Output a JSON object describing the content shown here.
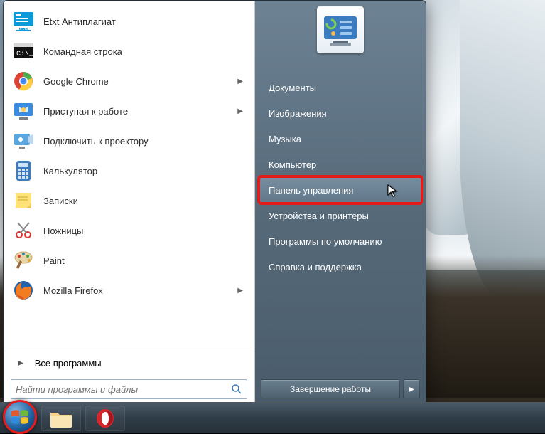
{
  "programs": [
    {
      "label": "Etxt Антиплагиат",
      "icon": "etxt",
      "hasSubmenu": false
    },
    {
      "label": "Командная строка",
      "icon": "cmd",
      "hasSubmenu": false
    },
    {
      "label": "Google Chrome",
      "icon": "chrome",
      "hasSubmenu": true
    },
    {
      "label": "Приступая к работе",
      "icon": "getting-started",
      "hasSubmenu": true
    },
    {
      "label": "Подключить к проектору",
      "icon": "projector",
      "hasSubmenu": false
    },
    {
      "label": "Калькулятор",
      "icon": "calculator",
      "hasSubmenu": false
    },
    {
      "label": "Записки",
      "icon": "sticky-notes",
      "hasSubmenu": false
    },
    {
      "label": "Ножницы",
      "icon": "snipping-tool",
      "hasSubmenu": false
    },
    {
      "label": "Paint",
      "icon": "paint",
      "hasSubmenu": false
    },
    {
      "label": "Mozilla Firefox",
      "icon": "firefox",
      "hasSubmenu": true
    }
  ],
  "all_programs_label": "Все программы",
  "search": {
    "placeholder": "Найти программы и файлы"
  },
  "right_items": [
    {
      "label": "Документы",
      "key": "documents"
    },
    {
      "label": "Изображения",
      "key": "pictures"
    },
    {
      "label": "Музыка",
      "key": "music"
    },
    {
      "label": "Компьютер",
      "key": "computer"
    },
    {
      "label": "Панель управления",
      "key": "control-panel",
      "highlighted": true
    },
    {
      "label": "Устройства и принтеры",
      "key": "devices-printers"
    },
    {
      "label": "Программы по умолчанию",
      "key": "default-programs"
    },
    {
      "label": "Справка и поддержка",
      "key": "help-support"
    }
  ],
  "shutdown_label": "Завершение работы",
  "user_picture": "control-panel-icon",
  "taskbar": {
    "pinned": [
      {
        "key": "explorer",
        "icon": "folder"
      },
      {
        "key": "opera",
        "icon": "opera"
      }
    ]
  },
  "colors": {
    "highlight_border": "#e41b1b",
    "right_panel_text": "#ffffff"
  }
}
